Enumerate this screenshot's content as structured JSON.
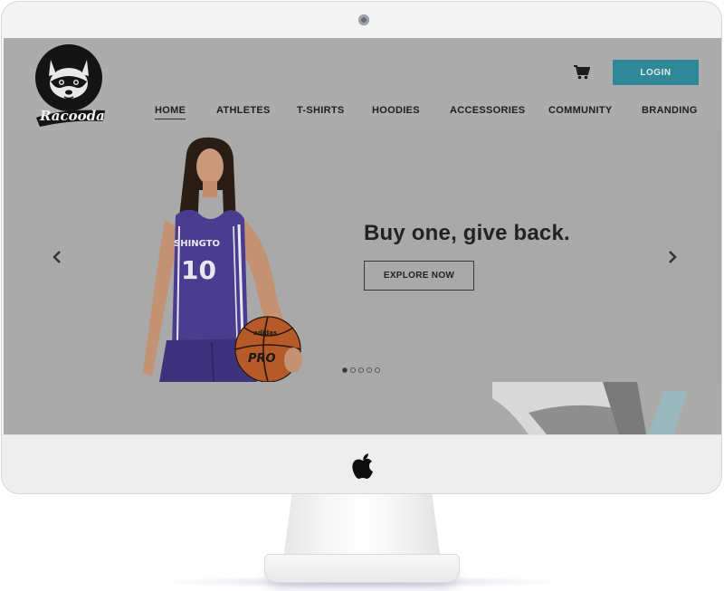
{
  "brand": {
    "name": "Racooda"
  },
  "header": {
    "login_label": "LOGIN",
    "cart_icon": "shopping-cart-icon"
  },
  "nav": {
    "items": [
      {
        "label": "HOME",
        "active": true
      },
      {
        "label": "ATHLETES",
        "active": false
      },
      {
        "label": "T-SHIRTS",
        "active": false
      },
      {
        "label": "HOODIES",
        "active": false
      },
      {
        "label": "ACCESSORIES",
        "active": false
      },
      {
        "label": "COMMUNITY",
        "active": false
      },
      {
        "label": "BRANDING",
        "active": false
      }
    ]
  },
  "hero": {
    "title": "Buy one, give back.",
    "cta_label": "EXPLORE NOW",
    "jersey_text": "SHINGTO",
    "jersey_number": "10",
    "ball_text": "PRO",
    "ball_brand": "adidas",
    "slides_total": 5,
    "active_slide": 1,
    "prev_icon": "chevron-left-icon",
    "next_icon": "chevron-right-icon"
  },
  "colors": {
    "accent": "#2e8897",
    "header_bg": "#acacac",
    "jersey": "#4a3d8f",
    "text": "#222222"
  }
}
